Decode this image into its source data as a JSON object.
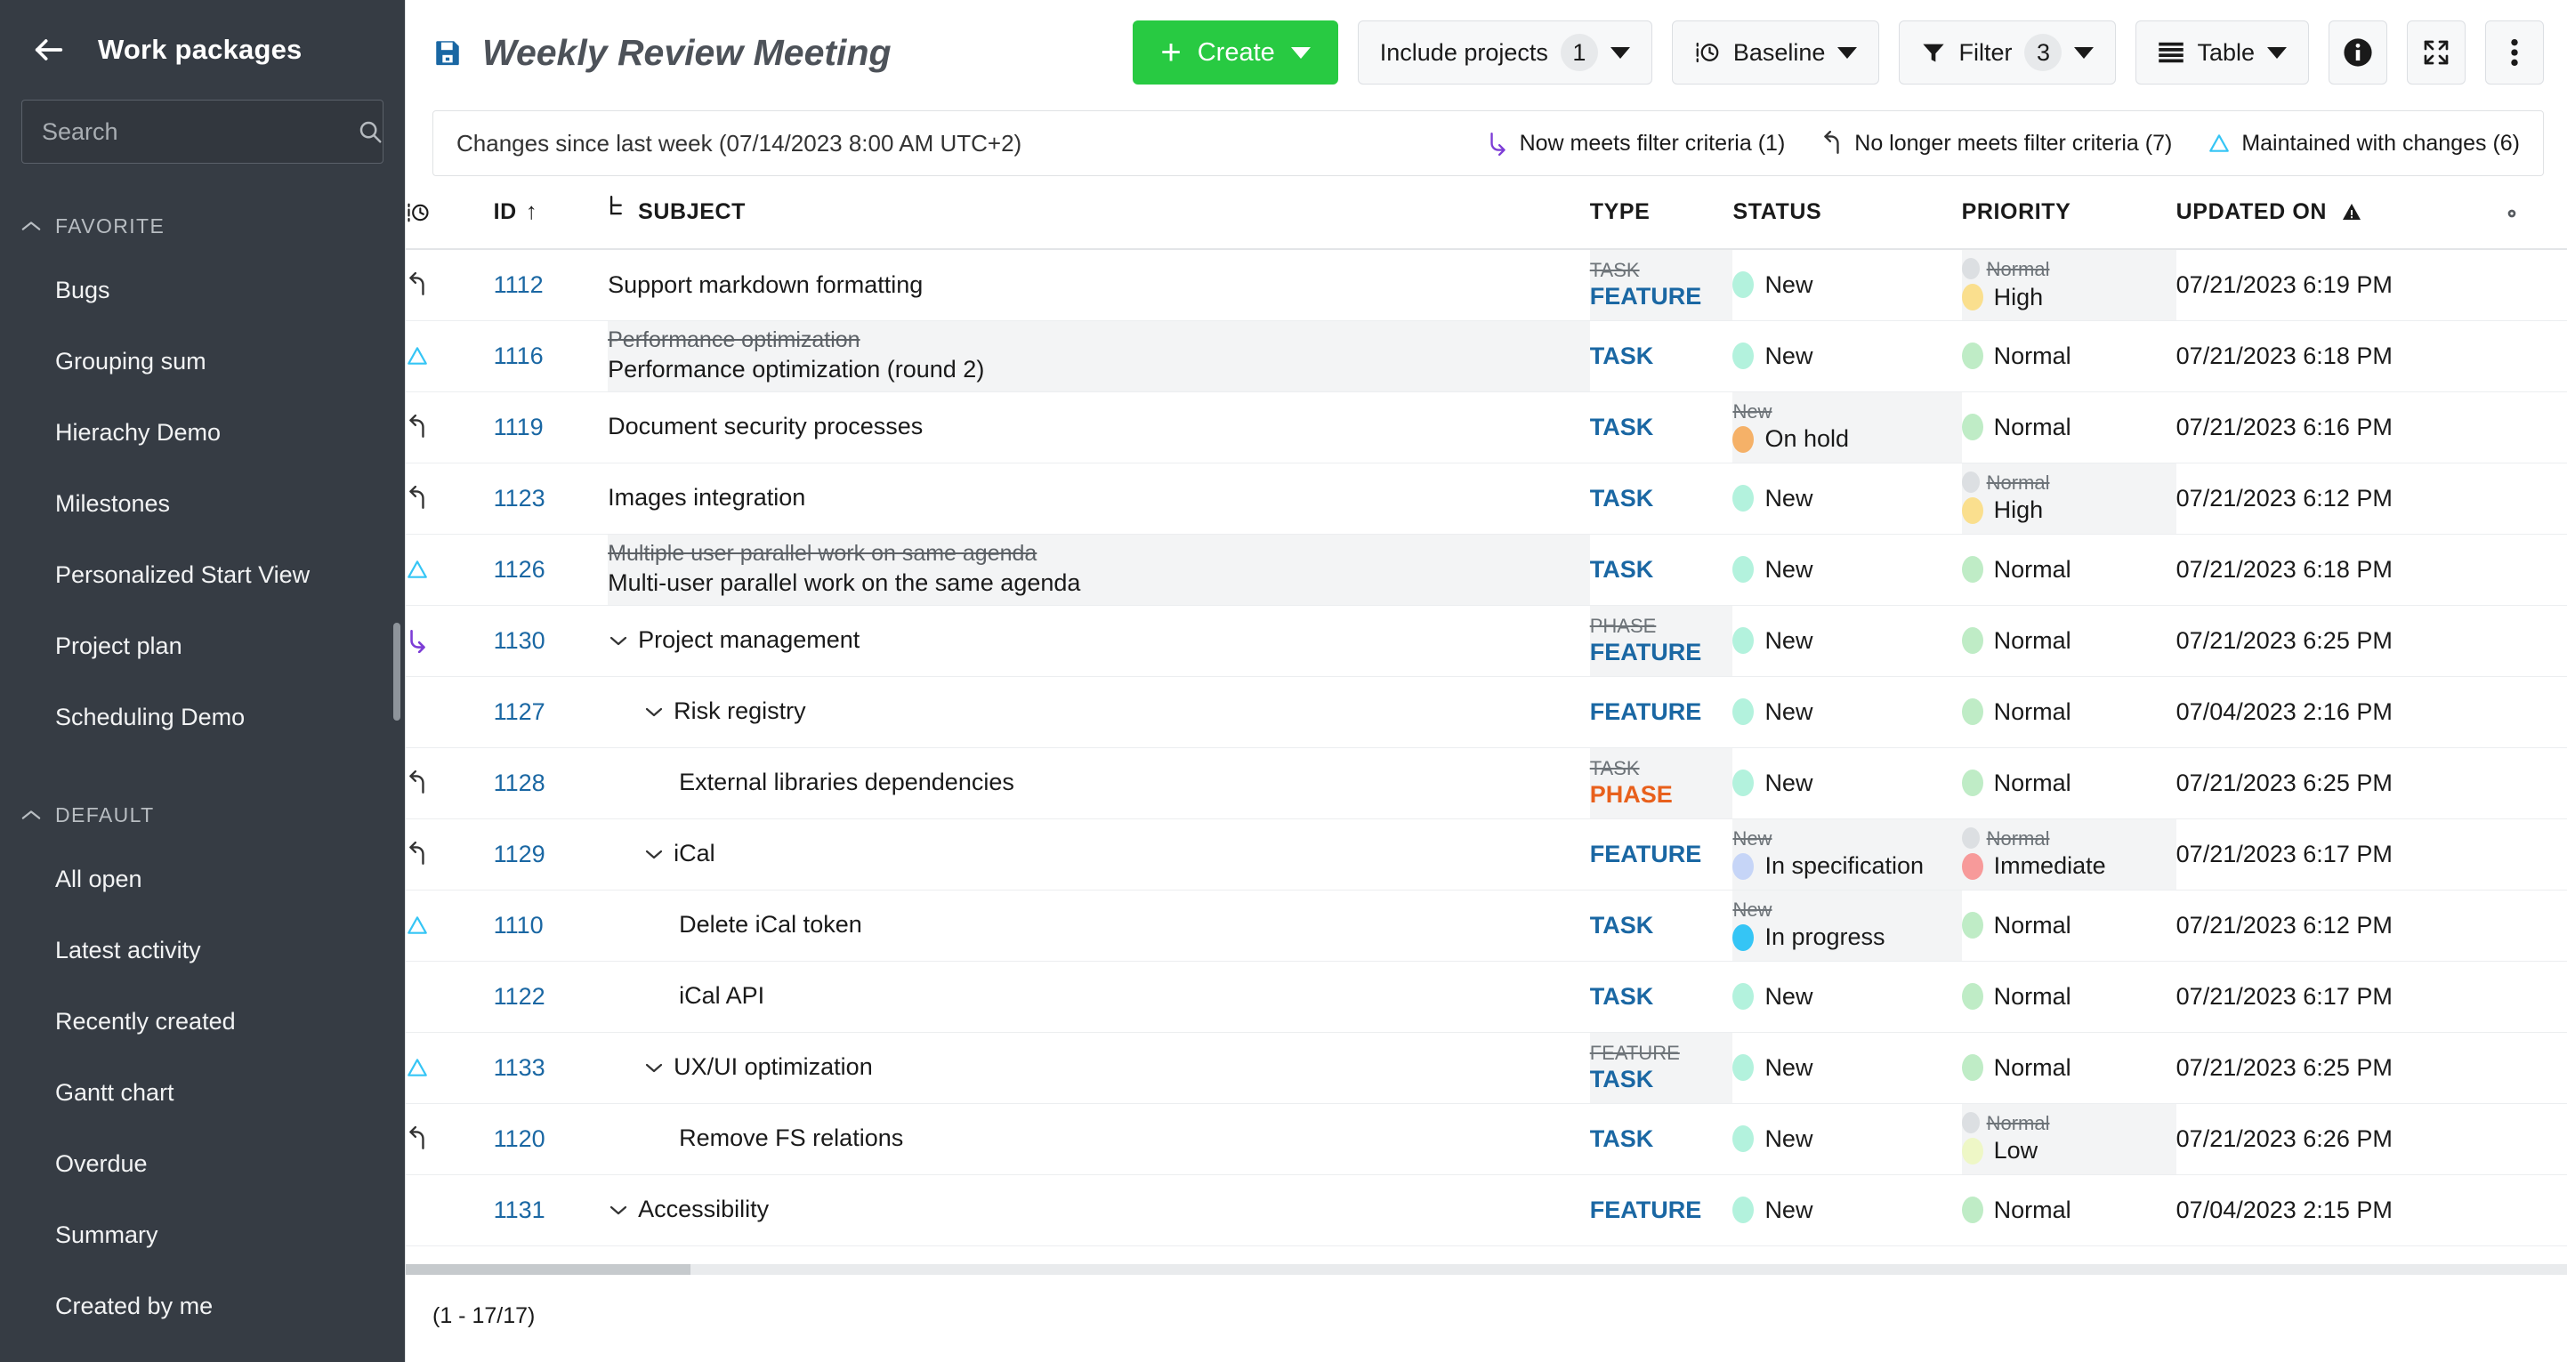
{
  "sidebar": {
    "title": "Work packages",
    "back_icon": "arrow-left-icon",
    "search": {
      "placeholder": "Search",
      "value": "",
      "icon": "search-icon"
    },
    "sections": [
      {
        "label": "FAVORITE",
        "collapsed": false,
        "items": [
          {
            "label": "Bugs"
          },
          {
            "label": "Grouping sum"
          },
          {
            "label": "Hierachy Demo"
          },
          {
            "label": "Milestones"
          },
          {
            "label": "Personalized Start View"
          },
          {
            "label": "Project plan"
          },
          {
            "label": "Scheduling Demo"
          }
        ]
      },
      {
        "label": "DEFAULT",
        "collapsed": false,
        "items": [
          {
            "label": "All open"
          },
          {
            "label": "Latest activity"
          },
          {
            "label": "Recently created"
          },
          {
            "label": "Gantt chart"
          },
          {
            "label": "Overdue"
          },
          {
            "label": "Summary"
          },
          {
            "label": "Created by me"
          }
        ]
      }
    ]
  },
  "toolbar": {
    "save_icon": "save-icon",
    "title": "Weekly Review Meeting",
    "create_label": "Create",
    "include_projects_label": "Include projects",
    "include_projects_count": "1",
    "baseline_label": "Baseline",
    "baseline_icon": "baseline-clock-icon",
    "filter_label": "Filter",
    "filter_count": "3",
    "filter_icon": "funnel-icon",
    "view_label": "Table",
    "view_icon": "table-rows-icon",
    "info_icon": "info-icon",
    "fullscreen_icon": "fullscreen-icon",
    "more_icon": "more-vertical-icon"
  },
  "baseline_bar": {
    "text": "Changes since last week (07/14/2023 8:00 AM UTC+2)",
    "legend": [
      {
        "icon": "arrow-turn-down-right-icon",
        "label": "Now meets filter criteria (1)",
        "color": "#7d3dd6"
      },
      {
        "icon": "arrow-turn-up-left-icon",
        "label": "No longer meets filter criteria (7)",
        "color": "#333333"
      },
      {
        "icon": "triangle-outline-icon",
        "label": "Maintained with changes (6)",
        "color": "#35c5f5"
      }
    ]
  },
  "table": {
    "columns": [
      {
        "key": "icon",
        "label": "",
        "icon": "baseline-clock-icon"
      },
      {
        "key": "id",
        "label": "ID",
        "sort": "asc"
      },
      {
        "key": "subject",
        "label": "SUBJECT",
        "icon": "hierarchy-icon"
      },
      {
        "key": "type",
        "label": "TYPE"
      },
      {
        "key": "status",
        "label": "STATUS"
      },
      {
        "key": "priority",
        "label": "PRIORITY"
      },
      {
        "key": "updated_on",
        "label": "UPDATED ON",
        "icon": "warning-triangle-icon"
      },
      {
        "key": "config",
        "label": "",
        "icon": "gear-icon"
      }
    ],
    "rows": [
      {
        "marker": "arrow-turn-up-left-icon",
        "id": "1112",
        "subject": "Support markdown formatting",
        "subject_old": "",
        "indent": 0,
        "expander": false,
        "type": "FEATURE",
        "type_old": "TASK",
        "status": "New",
        "status_old": "",
        "status_color": "#b3f2dd",
        "priority": "High",
        "priority_old": "Normal",
        "priority_color": "#fadf8e",
        "updated_on": "07/21/2023 6:19 PM"
      },
      {
        "marker": "triangle-outline-icon",
        "id": "1116",
        "subject": "Performance optimization (round 2)",
        "subject_old": "Performance optimization",
        "indent": 0,
        "expander": false,
        "type": "TASK",
        "type_old": "",
        "status": "New",
        "status_old": "",
        "status_color": "#b3f2dd",
        "priority": "Normal",
        "priority_old": "",
        "priority_color": "#bfecc6",
        "updated_on": "07/21/2023 6:18 PM"
      },
      {
        "marker": "arrow-turn-up-left-icon",
        "id": "1119",
        "subject": "Document security processes",
        "subject_old": "",
        "indent": 0,
        "expander": false,
        "type": "TASK",
        "type_old": "",
        "status": "On hold",
        "status_old": "New",
        "status_color": "#f5b168",
        "priority": "Normal",
        "priority_old": "",
        "priority_color": "#bfecc6",
        "updated_on": "07/21/2023 6:16 PM"
      },
      {
        "marker": "arrow-turn-up-left-icon",
        "id": "1123",
        "subject": "Images integration",
        "subject_old": "",
        "indent": 0,
        "expander": false,
        "type": "TASK",
        "type_old": "",
        "status": "New",
        "status_old": "",
        "status_color": "#b3f2dd",
        "priority": "High",
        "priority_old": "Normal",
        "priority_color": "#fadf8e",
        "updated_on": "07/21/2023 6:12 PM"
      },
      {
        "marker": "triangle-outline-icon",
        "id": "1126",
        "subject": "Multi-user parallel work on the same agenda",
        "subject_old": "Multiple user parallel work on same agenda",
        "indent": 0,
        "expander": false,
        "type": "TASK",
        "type_old": "",
        "status": "New",
        "status_old": "",
        "status_color": "#b3f2dd",
        "priority": "Normal",
        "priority_old": "",
        "priority_color": "#bfecc6",
        "updated_on": "07/21/2023 6:18 PM"
      },
      {
        "marker": "arrow-turn-down-right-icon",
        "id": "1130",
        "subject": "Project management",
        "subject_old": "",
        "indent": 0,
        "expander": true,
        "type": "FEATURE",
        "type_old": "PHASE",
        "status": "New",
        "status_old": "",
        "status_color": "#b3f2dd",
        "priority": "Normal",
        "priority_old": "",
        "priority_color": "#bfecc6",
        "updated_on": "07/21/2023 6:25 PM"
      },
      {
        "marker": "",
        "id": "1127",
        "subject": "Risk registry",
        "subject_old": "",
        "indent": 1,
        "expander": true,
        "type": "FEATURE",
        "type_old": "",
        "status": "New",
        "status_old": "",
        "status_color": "#b3f2dd",
        "priority": "Normal",
        "priority_old": "",
        "priority_color": "#bfecc6",
        "updated_on": "07/04/2023 2:16 PM"
      },
      {
        "marker": "arrow-turn-up-left-icon",
        "id": "1128",
        "subject": "External libraries dependencies",
        "subject_old": "",
        "indent": 2,
        "expander": false,
        "type": "PHASE",
        "type_old": "TASK",
        "status": "New",
        "status_old": "",
        "status_color": "#b3f2dd",
        "priority": "Normal",
        "priority_old": "",
        "priority_color": "#bfecc6",
        "updated_on": "07/21/2023 6:25 PM"
      },
      {
        "marker": "arrow-turn-up-left-icon",
        "id": "1129",
        "subject": "iCal",
        "subject_old": "",
        "indent": 1,
        "expander": true,
        "type": "FEATURE",
        "type_old": "",
        "status": "In specification",
        "status_old": "New",
        "status_color": "#c6d5f7",
        "priority": "Immediate",
        "priority_old": "Normal",
        "priority_color": "#f79a9a",
        "updated_on": "07/21/2023 6:17 PM"
      },
      {
        "marker": "triangle-outline-icon",
        "id": "1110",
        "subject": "Delete iCal token",
        "subject_old": "",
        "indent": 2,
        "expander": false,
        "type": "TASK",
        "type_old": "",
        "status": "In progress",
        "status_old": "New",
        "status_color": "#35c5f5",
        "priority": "Normal",
        "priority_old": "",
        "priority_color": "#bfecc6",
        "updated_on": "07/21/2023 6:12 PM"
      },
      {
        "marker": "",
        "id": "1122",
        "subject": "iCal API",
        "subject_old": "",
        "indent": 2,
        "expander": false,
        "type": "TASK",
        "type_old": "",
        "status": "New",
        "status_old": "",
        "status_color": "#b3f2dd",
        "priority": "Normal",
        "priority_old": "",
        "priority_color": "#bfecc6",
        "updated_on": "07/21/2023 6:17 PM"
      },
      {
        "marker": "triangle-outline-icon",
        "id": "1133",
        "subject": "UX/UI optimization",
        "subject_old": "",
        "indent": 1,
        "expander": true,
        "type": "TASK",
        "type_old": "FEATURE",
        "status": "New",
        "status_old": "",
        "status_color": "#b3f2dd",
        "priority": "Normal",
        "priority_old": "",
        "priority_color": "#bfecc6",
        "updated_on": "07/21/2023 6:25 PM"
      },
      {
        "marker": "arrow-turn-up-left-icon",
        "id": "1120",
        "subject": "Remove FS relations",
        "subject_old": "",
        "indent": 2,
        "expander": false,
        "type": "TASK",
        "type_old": "",
        "status": "New",
        "status_old": "",
        "status_color": "#b3f2dd",
        "priority": "Low",
        "priority_old": "Normal",
        "priority_color": "#eef7c6",
        "updated_on": "07/21/2023 6:26 PM"
      },
      {
        "marker": "",
        "id": "1131",
        "subject": "Accessibility",
        "subject_old": "",
        "indent": 0,
        "expander": true,
        "type": "FEATURE",
        "type_old": "",
        "status": "New",
        "status_old": "",
        "status_color": "#b3f2dd",
        "priority": "Normal",
        "priority_old": "",
        "priority_color": "#bfecc6",
        "updated_on": "07/04/2023 2:15 PM"
      }
    ]
  },
  "footer": {
    "pager": "(1 - 17/17)"
  },
  "colors": {
    "accent_green": "#28ca42",
    "link_blue": "#1a67a3",
    "phase_orange": "#e8601c",
    "sidebar_bg": "#363c44",
    "baseline_added": "#7d3dd6",
    "baseline_changed": "#35c5f5"
  }
}
